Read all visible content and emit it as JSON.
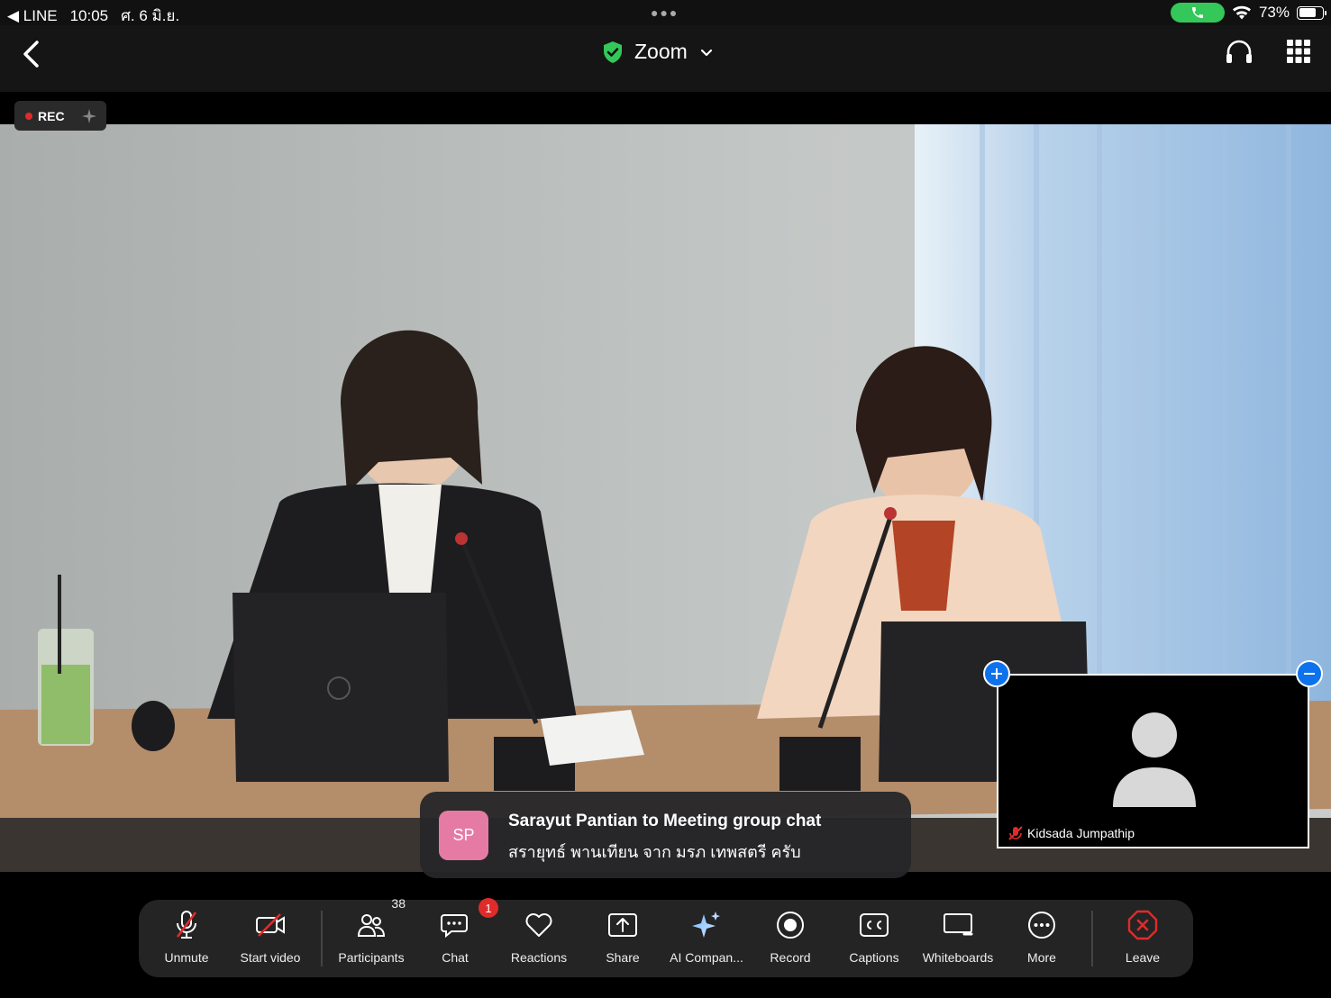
{
  "status_bar": {
    "back_app": "◀ LINE",
    "time": "10:05",
    "date": "ศ. 6 มิ.ย.",
    "battery": "73%",
    "battery_level": 0.73
  },
  "header": {
    "title": "Zoom"
  },
  "rec_label": "REC",
  "self_view": {
    "name": "Kidsada Jumpathip"
  },
  "chat_toast": {
    "initials": "SP",
    "title": "Sarayut Pantian to Meeting group chat",
    "message": "สรายุทธ์ พานเทียน จาก มรภ เทพสตรี ครับ"
  },
  "toolbar": {
    "unmute": "Unmute",
    "start_video": "Start video",
    "participants": "Participants",
    "participants_count": "38",
    "chat": "Chat",
    "chat_badge": "1",
    "reactions": "Reactions",
    "share": "Share",
    "ai_companion": "AI Compan...",
    "record": "Record",
    "captions": "Captions",
    "whiteboards": "Whiteboards",
    "more": "More",
    "leave": "Leave"
  },
  "colors": {
    "accent_blue": "#0e72ed",
    "leave_red": "#e02b2b",
    "shield_green": "#34c759",
    "avatar_pink": "#e57ba5"
  }
}
